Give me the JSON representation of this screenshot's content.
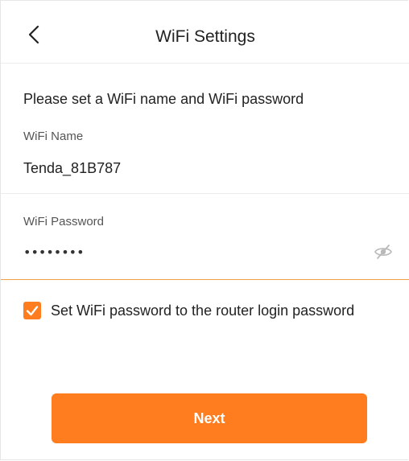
{
  "header": {
    "title": "WiFi Settings",
    "back_icon": "chevron-left-icon"
  },
  "form": {
    "intro": "Please set a WiFi name and WiFi password",
    "wifi_name": {
      "label": "WiFi Name",
      "value": "Tenda_81B787"
    },
    "wifi_password": {
      "label": "WiFi Password",
      "masked_value": "••••••••",
      "visibility_icon": "eye-off-icon"
    },
    "same_password_option": {
      "label": "Set WiFi password to the router login password",
      "checked": true
    }
  },
  "actions": {
    "next_label": "Next"
  },
  "colors": {
    "accent": "#ff7d1e",
    "focus_line": "#f0a040",
    "divider": "#ececec"
  }
}
